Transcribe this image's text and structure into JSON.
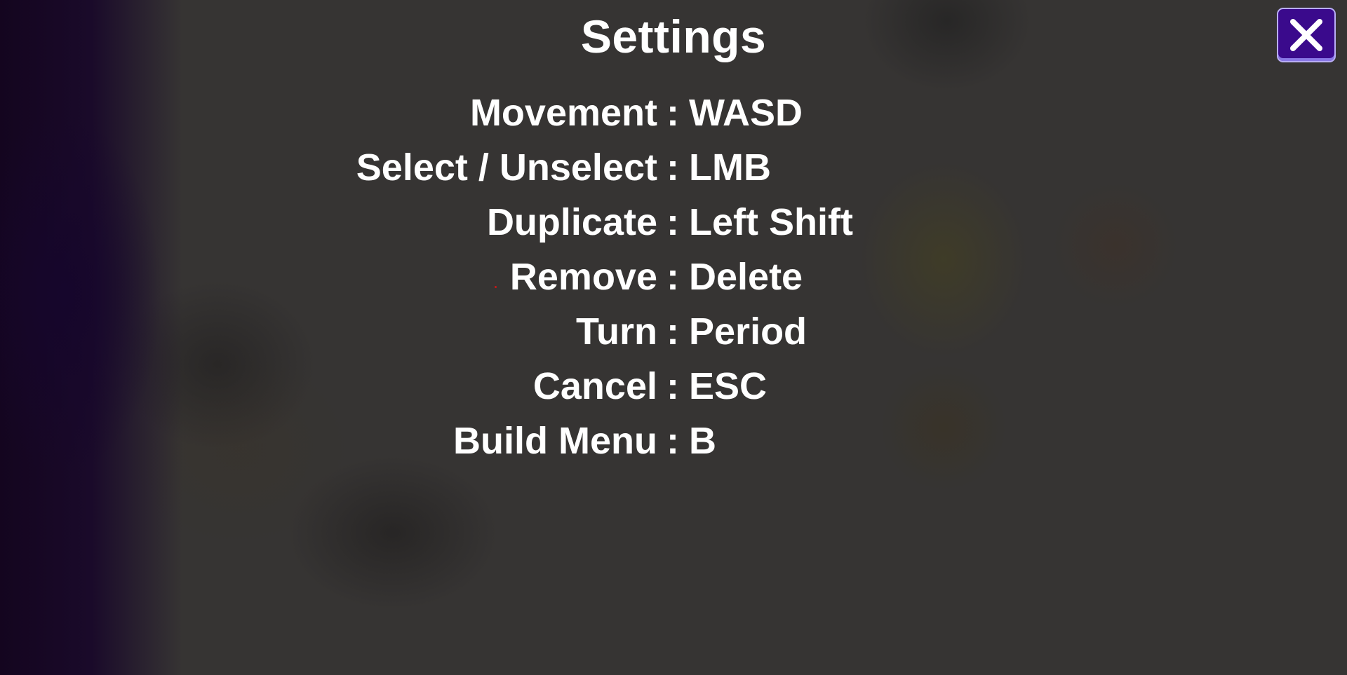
{
  "settings": {
    "title": "Settings",
    "close_icon": "close-x-icon",
    "separator": ":",
    "bindings": [
      {
        "action": "Movement",
        "key": "WASD"
      },
      {
        "action": "Select / Unselect",
        "key": "LMB"
      },
      {
        "action": "Duplicate",
        "key": "Left Shift"
      },
      {
        "action": "Remove",
        "key": "Delete"
      },
      {
        "action": "Turn",
        "key": "Period"
      },
      {
        "action": "Cancel",
        "key": "ESC"
      },
      {
        "action": "Build Menu",
        "key": "B"
      }
    ]
  },
  "colors": {
    "overlay_background": "#363433",
    "close_button": "#3a0a8c",
    "close_button_border": "#b9aef5",
    "text": "#ffffff"
  }
}
